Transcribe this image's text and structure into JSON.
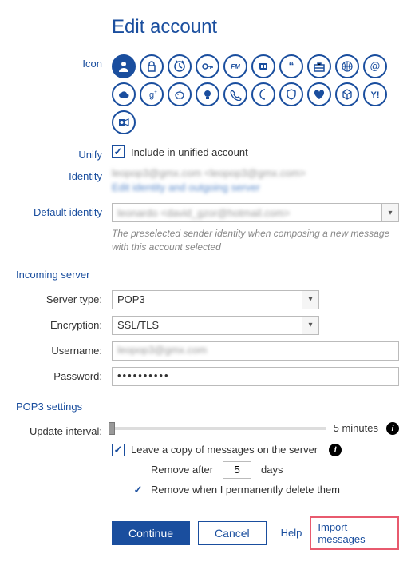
{
  "title": "Edit account",
  "labels": {
    "icon": "Icon",
    "unify": "Unify",
    "identity": "Identity",
    "default_identity": "Default identity",
    "server_type": "Server type:",
    "encryption": "Encryption:",
    "username": "Username:",
    "password": "Password:",
    "update_interval": "Update interval:"
  },
  "sections": {
    "incoming_server": "Incoming server",
    "pop3_settings": "POP3 settings"
  },
  "icons": [
    "person-icon",
    "lock-icon",
    "clock-icon",
    "key-icon",
    "fm-icon",
    "mastodon-icon",
    "quote-icon",
    "briefcase-icon",
    "globe-icon",
    "at-icon",
    "cloud-icon",
    "g-plus-icon",
    "piggy-icon",
    "bulb-icon",
    "phone-icon",
    "moon-icon",
    "shield-icon",
    "heart-icon",
    "cube-icon",
    "yahoo-icon",
    "outlook-icon"
  ],
  "selected_icon_index": 0,
  "unify": {
    "checked": true,
    "label": "Include in unified account"
  },
  "identity": {
    "line1": "leopop3@gmx.com <leopop3@gmx.com>",
    "line2": "Edit identity and outgoing server"
  },
  "default_identity": {
    "value": "leonardo <david_gzor@hotmail.com>",
    "helper": "The preselected sender identity when composing a new message with this account selected"
  },
  "server": {
    "type": "POP3",
    "encryption": "SSL/TLS",
    "username": "leopop3@gmx.com",
    "password": "••••••••••"
  },
  "pop3": {
    "interval_label": "5 minutes",
    "leave_copy": {
      "checked": true,
      "label": "Leave a copy of messages on the server"
    },
    "remove_after": {
      "checked": false,
      "label_before": "Remove after",
      "days": "5",
      "label_after": "days"
    },
    "remove_delete": {
      "checked": true,
      "label": "Remove when I permanently delete them"
    }
  },
  "buttons": {
    "continue": "Continue",
    "cancel": "Cancel",
    "help": "Help",
    "import": "Import messages"
  }
}
